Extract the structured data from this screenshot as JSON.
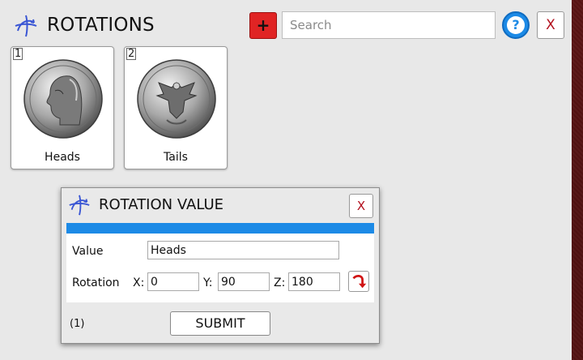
{
  "app": {
    "title": "ROTATIONS",
    "logo_icon": "rotation-axes-icon"
  },
  "toolbar": {
    "add_label": "+",
    "search_placeholder": "Search",
    "search_value": "",
    "help_label": "?",
    "close_label": "X"
  },
  "cards": [
    {
      "number": "1",
      "label": "Heads",
      "image": "quarter-heads-coin"
    },
    {
      "number": "2",
      "label": "Tails",
      "image": "quarter-tails-coin"
    }
  ],
  "dialog": {
    "title": "ROTATION VALUE",
    "close_label": "X",
    "progress": 1.0,
    "value_label": "Value",
    "value": "Heads",
    "rotation_label": "Rotation",
    "x_label": "X:",
    "x_value": "0",
    "y_label": "Y:",
    "y_value": "90",
    "z_label": "Z:",
    "z_value": "180",
    "rotate_icon": "rotate-arrow-icon",
    "count": "(1)",
    "submit_label": "SUBMIT"
  },
  "colors": {
    "accent": "#1c8ae6",
    "add_button": "#e02424",
    "close_text": "#b3101e",
    "background": "#5a1414"
  }
}
